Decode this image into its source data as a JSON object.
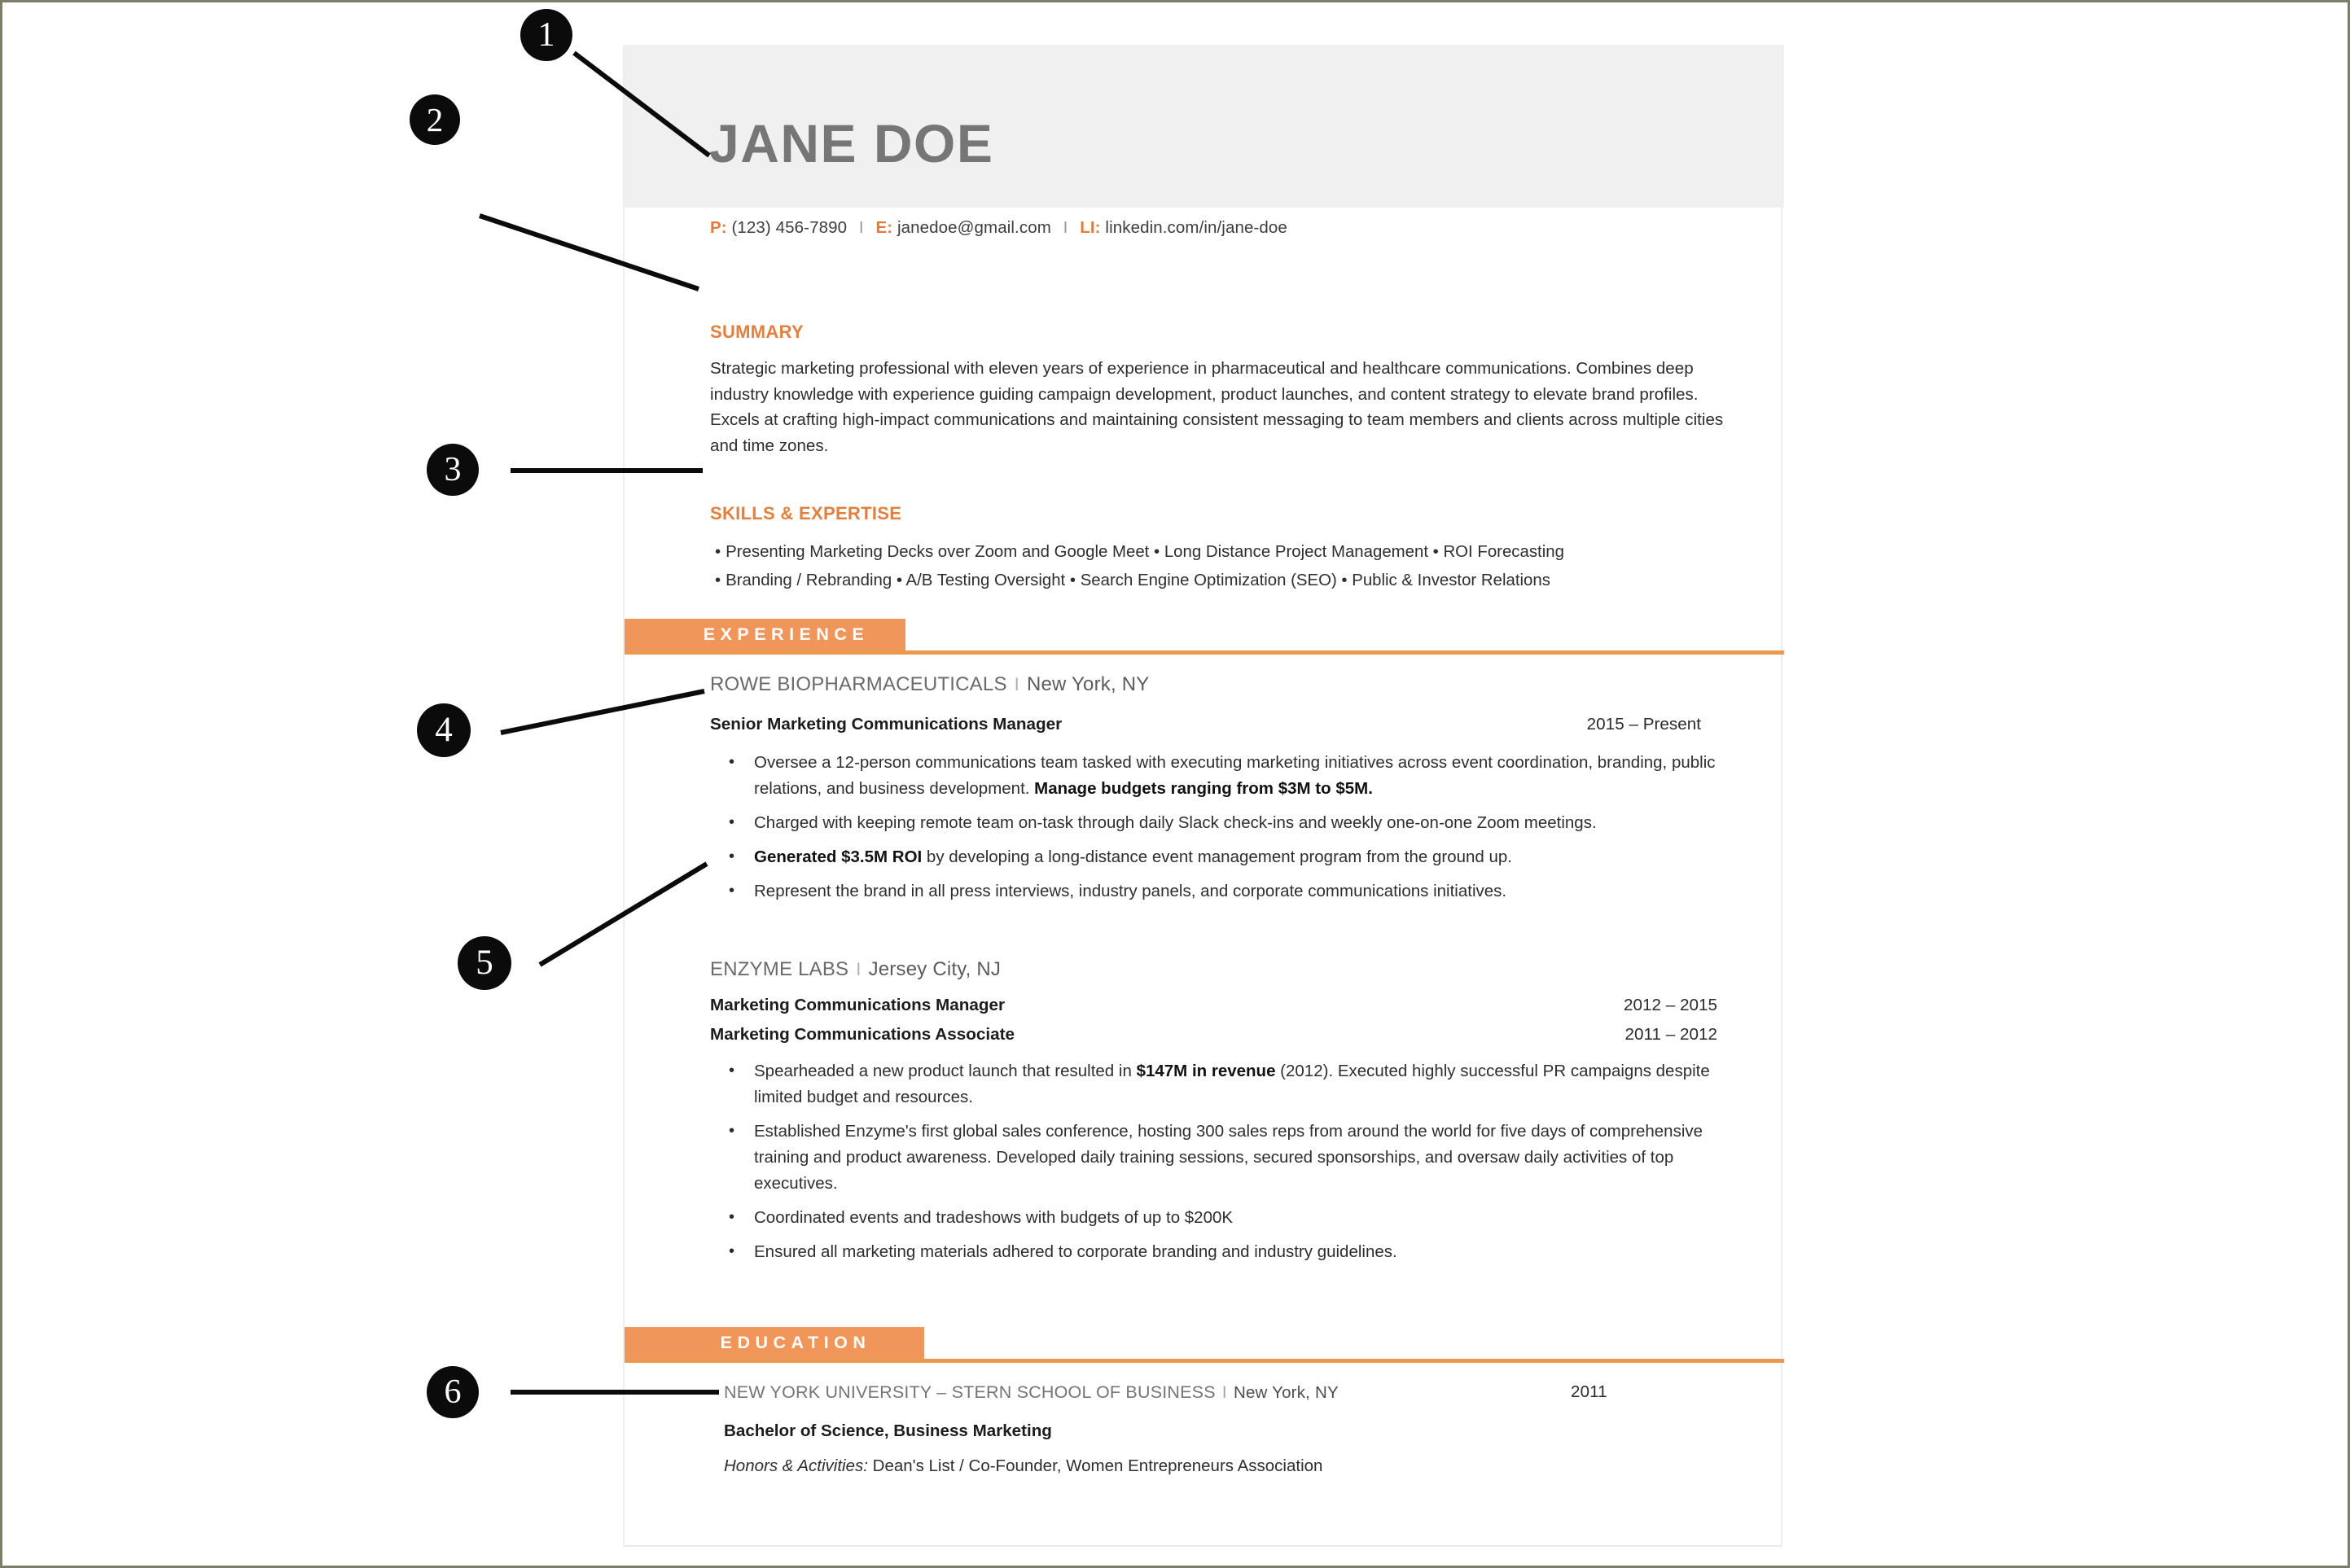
{
  "document": {
    "type": "resume",
    "accent_color": "#e2803f",
    "band_color": "#f1965a",
    "header_band_color": "#f0f0f0",
    "name_color": "#767676"
  },
  "header": {
    "name": "JANE DOE",
    "contact": {
      "phone_label": "P:",
      "phone": "(123) 456-7890",
      "email_label": "E:",
      "email": "janedoe@gmail.com",
      "linkedin_label": "LI:",
      "linkedin": "linkedin.com/in/jane-doe",
      "separator": "I"
    }
  },
  "summary": {
    "heading": "SUMMARY",
    "body": "Strategic marketing professional with eleven years of experience in pharmaceutical and healthcare communications. Combines deep industry knowledge with experience guiding campaign development, product launches, and content strategy to elevate brand profiles. Excels at crafting high-impact communications and maintaining consistent messaging to team members and clients across multiple cities and time zones."
  },
  "skills": {
    "heading": "SKILLS & EXPERTISE",
    "row1": "Presenting Marketing Decks over Zoom and Google Meet  •  Long Distance Project Management  •  ROI Forecasting",
    "row2": "Branding / Rebranding  •  A/B Testing Oversight • Search Engine Optimization (SEO)  •  Public & Investor Relations",
    "bullet_char": "•"
  },
  "experience": {
    "band_label": "EXPERIENCE",
    "jobs": [
      {
        "company": "ROWE BIOPHARMACEUTICALS",
        "separator": "I",
        "location": "New York, NY",
        "titles": [
          {
            "title": "Senior Marketing Communications Manager",
            "dates": "2015 – Present"
          }
        ],
        "bullets": [
          {
            "pre": "Oversee a 12-person communications team tasked with executing marketing initiatives across event coordination, branding, public relations, and business development. ",
            "bold": "Manage budgets ranging from $3M to $5M.",
            "post": ""
          },
          {
            "pre": "Charged with keeping remote team on-task through daily Slack check-ins and weekly one-on-one Zoom meetings.",
            "bold": "",
            "post": ""
          },
          {
            "pre": "",
            "bold": "Generated $3.5M ROI",
            "post": " by developing a long-distance event management program from the ground up."
          },
          {
            "pre": "Represent the brand in all press interviews, industry panels, and corporate communications initiatives.",
            "bold": "",
            "post": ""
          }
        ]
      },
      {
        "company": "ENZYME LABS",
        "separator": "I",
        "location": "Jersey City, NJ",
        "titles": [
          {
            "title": "Marketing Communications Manager",
            "dates": "2012 – 2015"
          },
          {
            "title": "Marketing Communications Associate",
            "dates": "2011 – 2012"
          }
        ],
        "bullets": [
          {
            "pre": " Spearheaded a new product launch that resulted in ",
            "bold": "$147M in revenue",
            "post": " (2012). Executed highly successful PR campaigns despite limited budget and resources."
          },
          {
            "pre": "Established Enzyme's first global sales conference, hosting 300 sales reps from around the world for five days of comprehensive training and product awareness. Developed daily training sessions, secured sponsorships, and oversaw daily activities of top executives.",
            "bold": "",
            "post": ""
          },
          {
            "pre": "Coordinated events and tradeshows with budgets of up to $200K",
            "bold": "",
            "post": ""
          },
          {
            "pre": "Ensured all marketing materials adhered to corporate branding and industry guidelines.",
            "bold": "",
            "post": ""
          }
        ]
      }
    ]
  },
  "education": {
    "band_label": "EDUCATION",
    "school": "NEW YORK UNIVERSITY – STERN SCHOOL OF BUSINESS",
    "separator": "I",
    "location": "New York, NY",
    "year": "2011",
    "degree": "Bachelor of Science, Business Marketing",
    "honors_label": "Honors & Activities:",
    "honors_value": " Dean's List / Co-Founder, Women Entrepreneurs Association"
  },
  "callouts": [
    {
      "number": "1"
    },
    {
      "number": "2"
    },
    {
      "number": "3"
    },
    {
      "number": "4"
    },
    {
      "number": "5"
    },
    {
      "number": "6"
    }
  ]
}
